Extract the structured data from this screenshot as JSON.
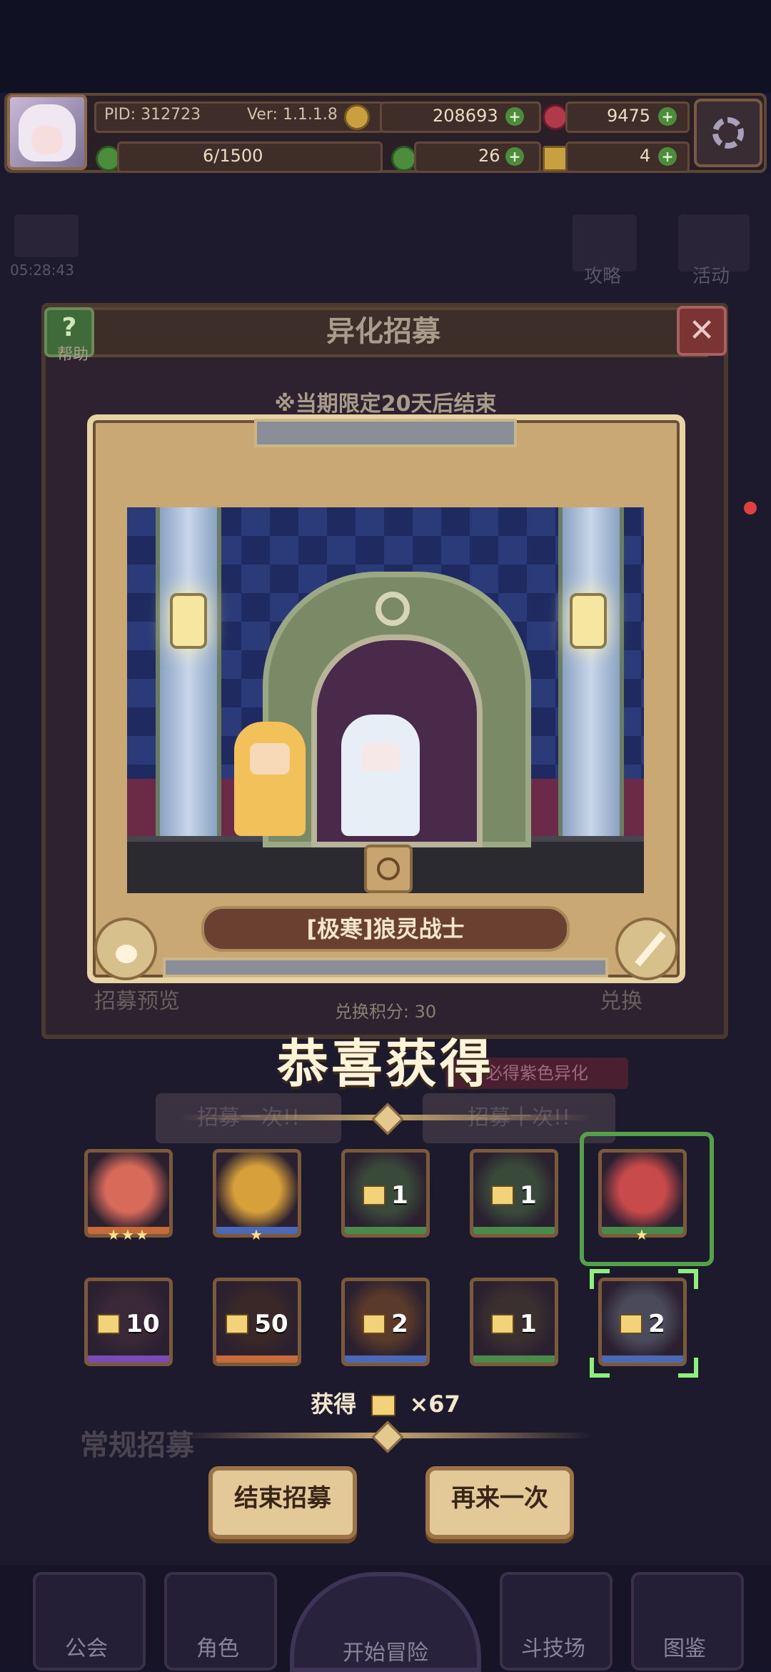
{
  "header": {
    "pid": "PID: 312723",
    "version": "Ver: 1.1.1.8",
    "gold": "208693",
    "gems": "9475",
    "stamina": "6/1500",
    "clover": "26",
    "boots": "4",
    "timer": "05:28:43"
  },
  "background": {
    "guide": "攻略",
    "event": "活动"
  },
  "dialog": {
    "title": "异化招募",
    "help_label": "帮助",
    "close_label": "✕",
    "limited_notice": "※当期限定20天后结束",
    "preview_label": "招募预览",
    "exchange_label": "兑换",
    "exchange_points": "兑换积分: 30",
    "purple_hint": "必得紫色异化",
    "pull_one": "招募一次!!",
    "pull_ten": "招募十次!!"
  },
  "showcase": {
    "character_name": "[极寒]狼灵战士"
  },
  "result": {
    "title": "恭喜获得",
    "rewards_row1": [
      {
        "type": "character",
        "stars": "★★★",
        "rarity_color": "#c86a3a",
        "portrait": "#d86a5a"
      },
      {
        "type": "character",
        "stars": "★",
        "rarity_color": "#4a6ab8",
        "portrait": "#d8a03a"
      },
      {
        "type": "fragment",
        "count": "1",
        "rarity_color": "#4a8a4a",
        "portrait": "#3a4a3a"
      },
      {
        "type": "fragment",
        "count": "1",
        "rarity_color": "#4a8a4a",
        "portrait": "#3a4a3a"
      },
      {
        "type": "character",
        "stars": "★",
        "rarity_color": "#4a8a4a",
        "portrait": "#c84a4a"
      }
    ],
    "rewards_row2": [
      {
        "type": "fragment",
        "count": "10",
        "rarity_color": "#7a4ab8",
        "portrait": "#3a2838"
      },
      {
        "type": "fragment",
        "count": "50",
        "rarity_color": "#c86a3a",
        "portrait": "#3a2828"
      },
      {
        "type": "fragment",
        "count": "2",
        "rarity_color": "#4a6ab8",
        "portrait": "#5a3a2a"
      },
      {
        "type": "fragment",
        "count": "1",
        "rarity_color": "#4a8a4a",
        "portrait": "#3a3030"
      },
      {
        "type": "fragment",
        "count": "2",
        "rarity_color": "#4a6ab8",
        "portrait": "#4a4a5a"
      }
    ],
    "gain_prefix": "获得",
    "gain_count": "×67"
  },
  "actions": {
    "end_label": "结束招募",
    "again_label": "再来一次",
    "normal_recruit": "常规招募"
  },
  "nav": {
    "guild": "公会",
    "character": "角色",
    "start": "开始冒险",
    "arena": "斗技场",
    "codex": "图鉴"
  },
  "colors": {
    "accent_gold": "#e3c898",
    "frame_gold": "#caa874",
    "highlight_green": "#8ef07a"
  }
}
